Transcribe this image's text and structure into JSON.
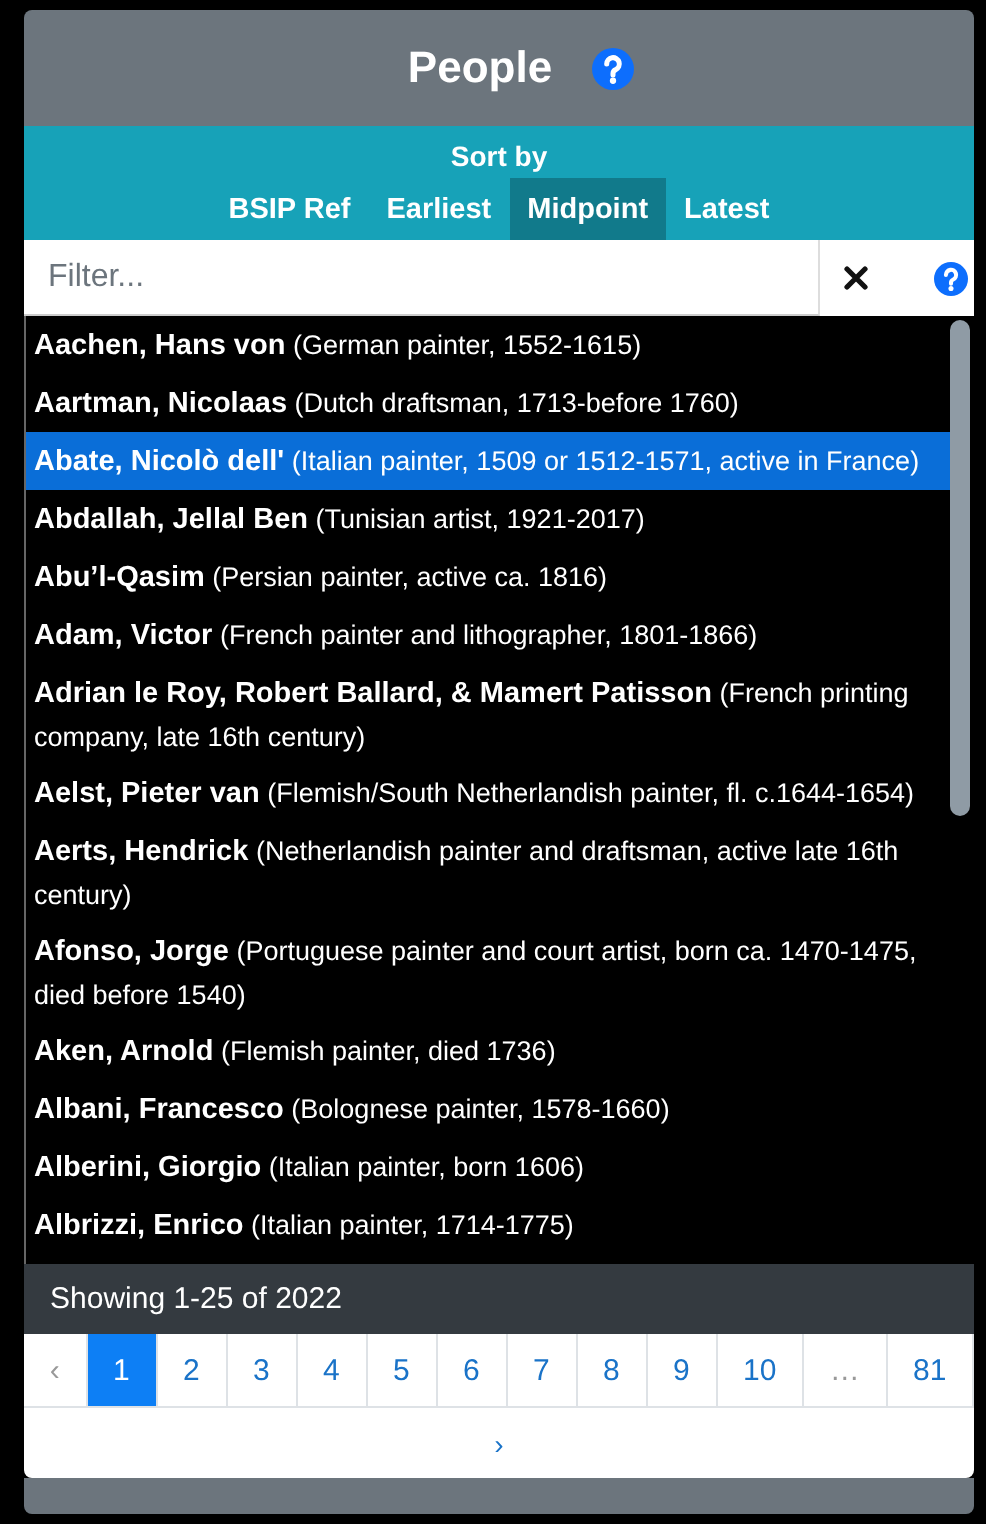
{
  "header": {
    "title": "People"
  },
  "sort": {
    "label": "Sort by",
    "options": [
      {
        "label": "BSIP Ref",
        "selected": false
      },
      {
        "label": "Earliest",
        "selected": false
      },
      {
        "label": "Midpoint",
        "selected": true
      },
      {
        "label": "Latest",
        "selected": false
      }
    ]
  },
  "filter": {
    "placeholder": "Filter..."
  },
  "people": [
    {
      "name": "Aachen, Hans von",
      "description": "(German painter, 1552-1615)",
      "selected": false
    },
    {
      "name": "Aartman, Nicolaas",
      "description": "(Dutch draftsman, 1713-before 1760)",
      "selected": false
    },
    {
      "name": "Abate, Nicolò dell'",
      "description": "(Italian painter, 1509 or 1512-1571, active in France)",
      "selected": true
    },
    {
      "name": "Abdallah, Jellal Ben",
      "description": "(Tunisian artist, 1921-2017)",
      "selected": false
    },
    {
      "name": "Abu’l-Qasim",
      "description": "(Persian painter, active ca. 1816)",
      "selected": false
    },
    {
      "name": "Adam, Victor",
      "description": "(French painter and lithographer, 1801-1866)",
      "selected": false
    },
    {
      "name": "Adrian le Roy, Robert Ballard, & Mamert Patisson",
      "description": "(French printing company, late 16th century)",
      "selected": false
    },
    {
      "name": "Aelst, Pieter van",
      "description": "(Flemish/South Netherlandish painter, fl. c.1644-1654)",
      "selected": false
    },
    {
      "name": "Aerts, Hendrick",
      "description": "(Netherlandish painter and draftsman, active late 16th century)",
      "selected": false
    },
    {
      "name": "Afonso, Jorge",
      "description": "(Portuguese painter and court artist, born ca. 1470-1475, died before 1540)",
      "selected": false
    },
    {
      "name": "Aken, Arnold",
      "description": "(Flemish painter, died 1736)",
      "selected": false
    },
    {
      "name": "Albani, Francesco",
      "description": "(Bolognese painter, 1578-1660)",
      "selected": false
    },
    {
      "name": "Alberini, Giorgio",
      "description": "(Italian painter, born 1606)",
      "selected": false
    },
    {
      "name": "Albrizzi, Enrico",
      "description": "(Italian painter, 1714-1775)",
      "selected": false
    }
  ],
  "status": "Showing 1-25 of 2022",
  "pagination": {
    "pages": [
      {
        "label": "‹",
        "selected": false,
        "disabled": true
      },
      {
        "label": "1",
        "selected": true,
        "disabled": false
      },
      {
        "label": "2",
        "selected": false,
        "disabled": false
      },
      {
        "label": "3",
        "selected": false,
        "disabled": false
      },
      {
        "label": "4",
        "selected": false,
        "disabled": false
      },
      {
        "label": "5",
        "selected": false,
        "disabled": false
      },
      {
        "label": "6",
        "selected": false,
        "disabled": false
      },
      {
        "label": "7",
        "selected": false,
        "disabled": false
      },
      {
        "label": "8",
        "selected": false,
        "disabled": false
      },
      {
        "label": "9",
        "selected": false,
        "disabled": false
      },
      {
        "label": "10",
        "selected": false,
        "disabled": false
      },
      {
        "label": "…",
        "selected": false,
        "disabled": true
      },
      {
        "label": "81",
        "selected": false,
        "disabled": false
      }
    ],
    "next": "›"
  }
}
